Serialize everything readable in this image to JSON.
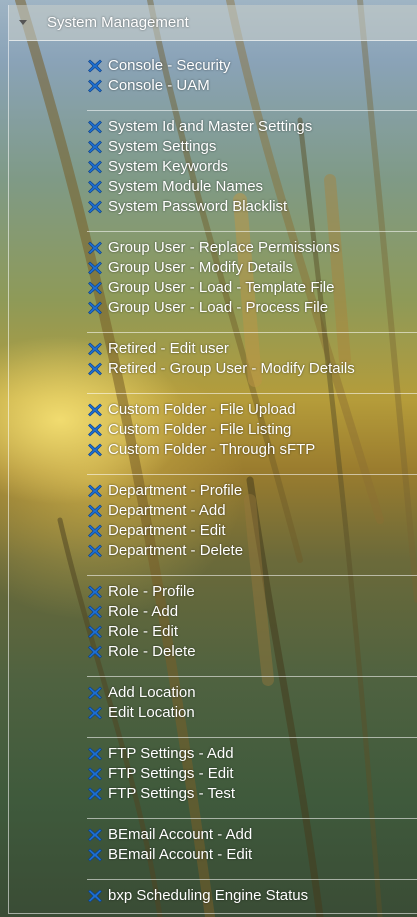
{
  "panel": {
    "title": "System Management",
    "expanded": true
  },
  "icons": {
    "item_icon": "x-icon",
    "toggle_icon": "caret-down-icon"
  },
  "colors": {
    "text": "#ffffff",
    "icon": "#1e6fd0"
  },
  "groups": [
    {
      "items": [
        "Console - Security",
        "Console - UAM"
      ]
    },
    {
      "items": [
        "System Id and Master Settings",
        "System Settings",
        "System Keywords",
        "System Module Names",
        "System Password Blacklist"
      ]
    },
    {
      "items": [
        "Group User - Replace Permissions",
        "Group User - Modify Details",
        "Group User - Load - Template File",
        "Group User - Load - Process File"
      ]
    },
    {
      "items": [
        "Retired - Edit user",
        "Retired - Group User - Modify Details"
      ]
    },
    {
      "items": [
        "Custom Folder - File Upload",
        "Custom Folder - File Listing",
        "Custom Folder - Through sFTP"
      ]
    },
    {
      "items": [
        "Department - Profile",
        "Department - Add",
        "Department - Edit",
        "Department - Delete"
      ]
    },
    {
      "items": [
        "Role - Profile",
        "Role - Add",
        "Role - Edit",
        "Role - Delete"
      ]
    },
    {
      "items": [
        "Add Location",
        "Edit Location"
      ]
    },
    {
      "items": [
        "FTP Settings - Add",
        "FTP Settings - Edit",
        "FTP Settings - Test"
      ]
    },
    {
      "items": [
        "BEmail Account - Add",
        "BEmail Account - Edit"
      ]
    },
    {
      "items": [
        "bxp Scheduling Engine Status"
      ]
    }
  ]
}
